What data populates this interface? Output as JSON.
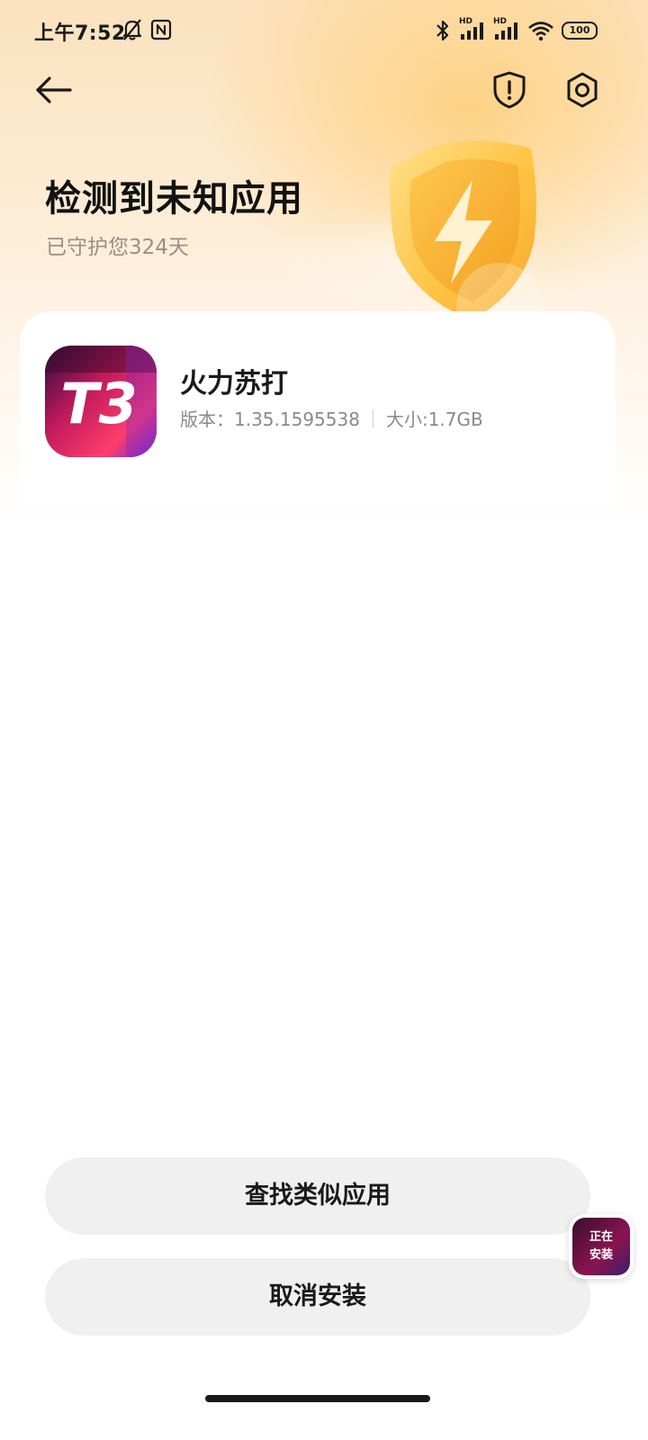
{
  "status_bar": {
    "time": "上午7:52",
    "battery": "100",
    "signal_1_label": "HD",
    "signal_2_label": "HD"
  },
  "header": {
    "title": "检测到未知应用",
    "subtitle": "已守护您324天"
  },
  "app": {
    "name": "火力苏打",
    "version": "版本：1.35.1595538",
    "size": "大小:1.7GB",
    "icon_text": "T3"
  },
  "actions": {
    "find_similar": "查找类似应用",
    "cancel_install": "取消安装"
  },
  "installing_badge": {
    "line1": "正在",
    "line2": "安装"
  },
  "colors": {
    "accent": "#f5b14a",
    "button_bg": "#f0f0f0"
  }
}
